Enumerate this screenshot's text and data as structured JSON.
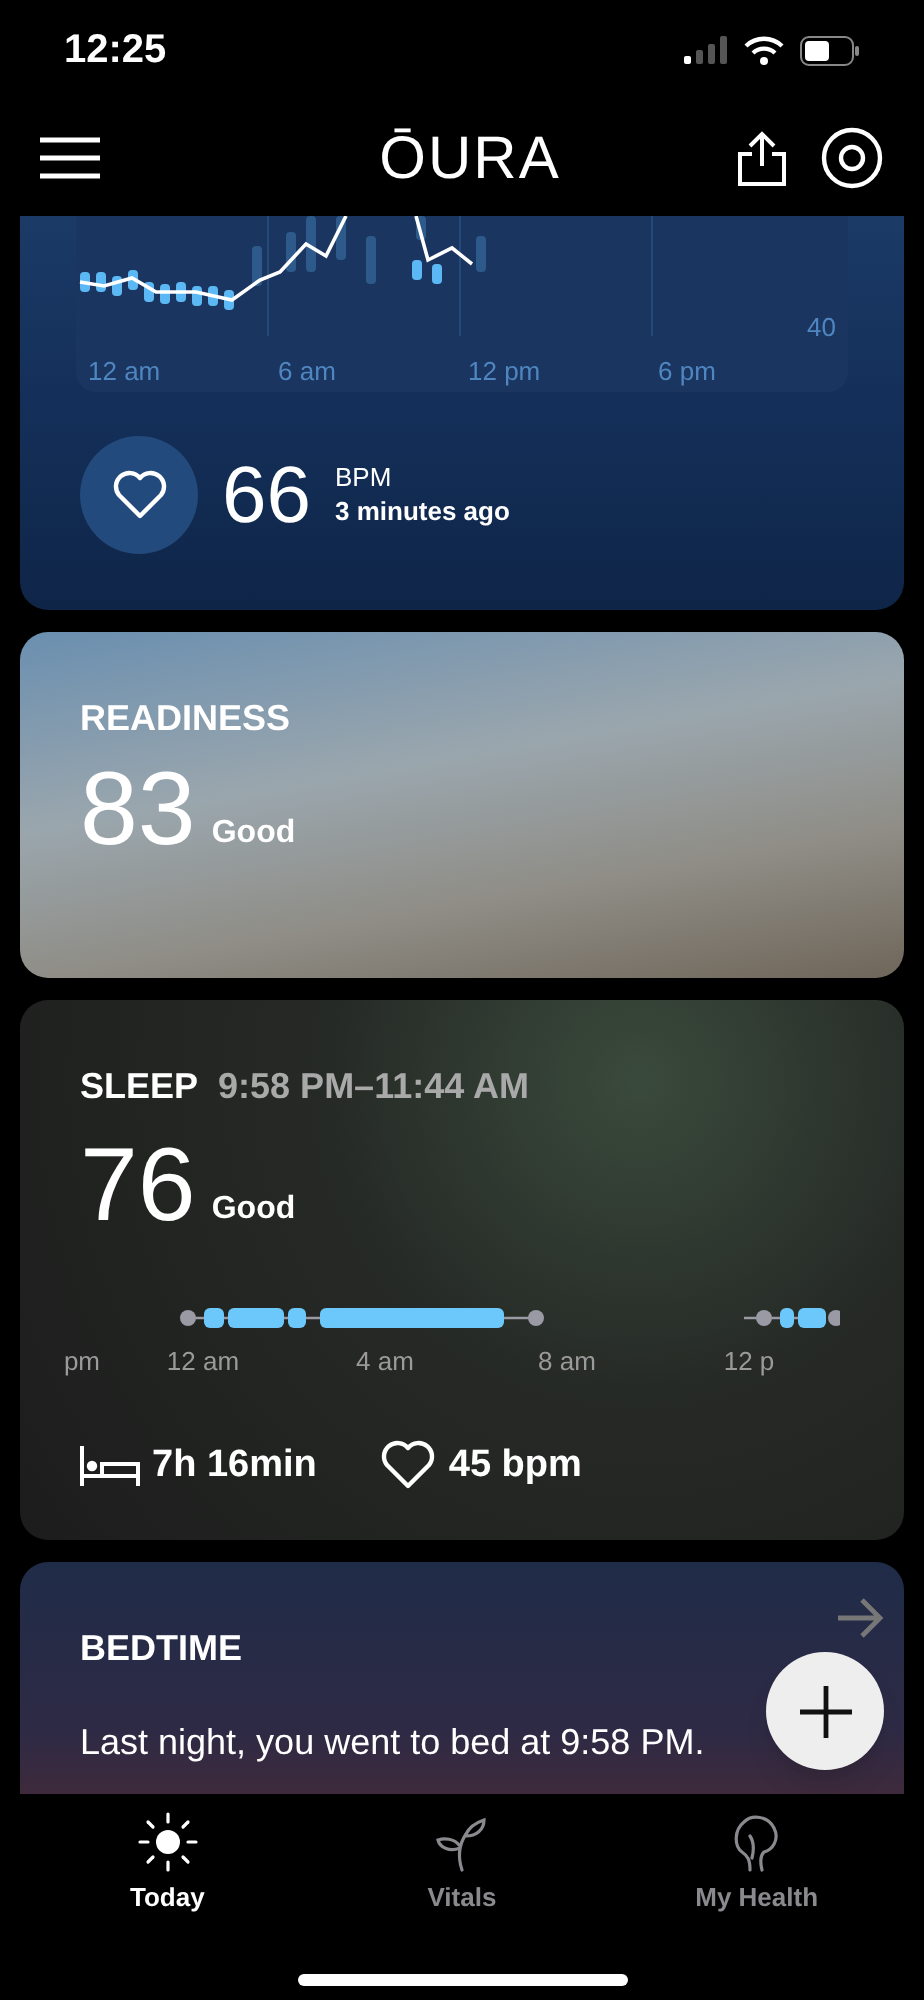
{
  "status_bar": {
    "time": "12:25"
  },
  "header": {
    "logo": "ŌURA"
  },
  "heart_rate": {
    "axis_labels": [
      "12 am",
      "6 am",
      "12 pm",
      "6 pm"
    ],
    "scale_label": "40",
    "value": "66",
    "unit": "BPM",
    "updated": "3 minutes ago"
  },
  "readiness": {
    "title": "READINESS",
    "score": "83",
    "rating": "Good"
  },
  "sleep": {
    "title": "SLEEP",
    "period": "9:58 PM–11:44 AM",
    "score": "76",
    "rating": "Good",
    "axis_labels": [
      "pm",
      "12 am",
      "4 am",
      "8 am",
      "12 p"
    ],
    "duration": "7h 16min",
    "heart_rate": "45 bpm"
  },
  "bedtime": {
    "title": "BEDTIME",
    "text": "Last night, you went to bed at 9:58 PM."
  },
  "tabs": [
    {
      "label": "Today",
      "selected": true
    },
    {
      "label": "Vitals",
      "selected": false
    },
    {
      "label": "My Health",
      "selected": false
    }
  ]
}
